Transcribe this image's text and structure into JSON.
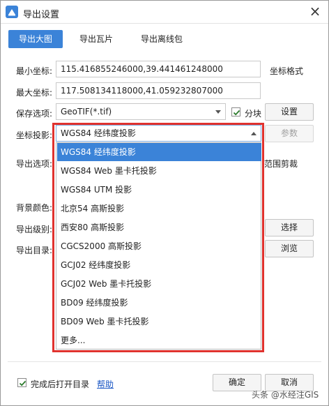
{
  "window": {
    "title": "导出设置",
    "close_glyph": "×"
  },
  "tabs": [
    {
      "label": "导出大图",
      "active": true
    },
    {
      "label": "导出瓦片",
      "active": false
    },
    {
      "label": "导出离线包",
      "active": false
    }
  ],
  "form": {
    "min_coord_label": "最小坐标:",
    "min_coord_value": "115.416855246000,39.441461248000",
    "coord_format_label": "坐标格式",
    "max_coord_label": "最大坐标:",
    "max_coord_value": "117.508134118000,41.059232807000",
    "save_option_label": "保存选项:",
    "save_option_value": "GeoTIF(*.tif)",
    "tile_label": "分块",
    "tile_checked": true,
    "settings_button": "设置",
    "projection_label": "坐标投影:",
    "projection_value": "WGS84 经纬度投影",
    "params_button": "参数",
    "export_option_label": "导出选项:",
    "crop_text_fragment": "范围剪裁",
    "bg_color_label": "背景颜色:",
    "export_level_label": "导出级别:",
    "select_button": "选择",
    "export_dir_label": "导出目录:",
    "browse_button": "浏览"
  },
  "projection_options": [
    {
      "label": "WGS84 经纬度投影",
      "selected": true
    },
    {
      "label": "WGS84 Web 墨卡托投影",
      "selected": false
    },
    {
      "label": "WGS84 UTM 投影",
      "selected": false
    },
    {
      "label": "北京54 高斯投影",
      "selected": false
    },
    {
      "label": "西安80 高斯投影",
      "selected": false
    },
    {
      "label": "CGCS2000 高斯投影",
      "selected": false
    },
    {
      "label": "GCJ02 经纬度投影",
      "selected": false
    },
    {
      "label": "GCJ02 Web 墨卡托投影",
      "selected": false
    },
    {
      "label": "BD09 经纬度投影",
      "selected": false
    },
    {
      "label": "BD09 Web 墨卡托投影",
      "selected": false
    },
    {
      "label": "更多...",
      "selected": false
    }
  ],
  "footer": {
    "open_dir_label": "完成后打开目录",
    "open_dir_checked": true,
    "help_link": "帮助",
    "ok_button": "确定",
    "cancel_button": "取消"
  },
  "watermark": "头条 @水经注GIS",
  "colors": {
    "accent": "#3b83d8",
    "highlight_border": "#e0322e",
    "link": "#1a56c4"
  }
}
